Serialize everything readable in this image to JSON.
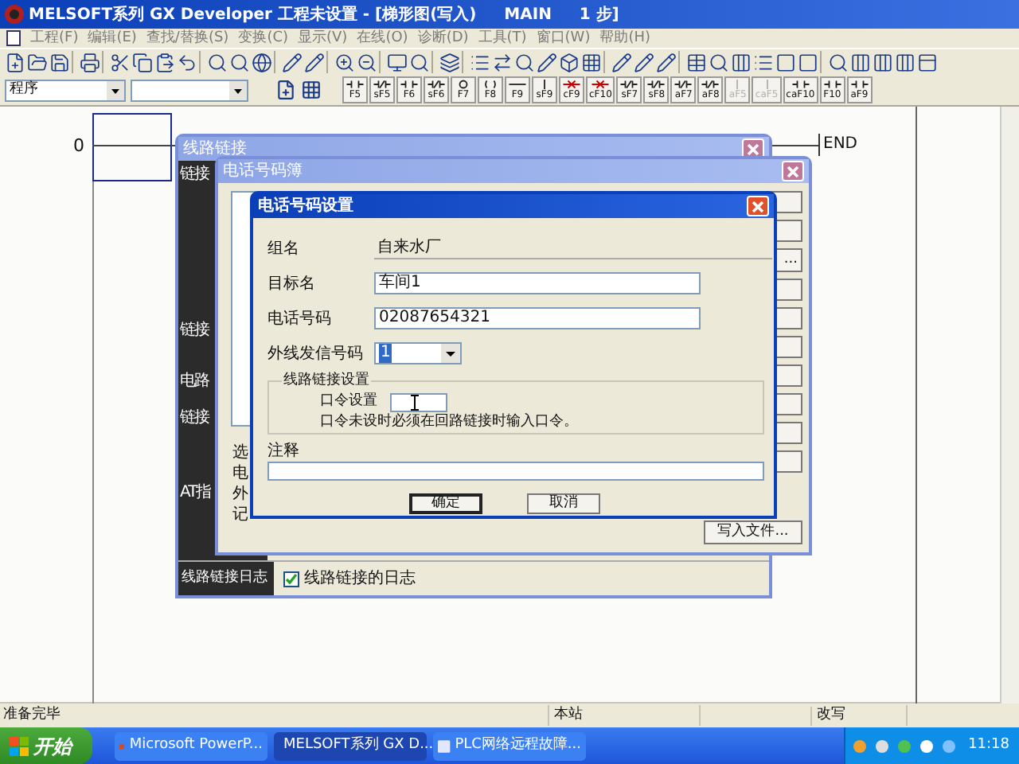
{
  "window": {
    "title": "MELSOFT系列 GX Developer 工程未设置 - [梯形图(写入)     MAIN     1 步]"
  },
  "menu": [
    "工程(F)",
    "编辑(E)",
    "查找/替换(S)",
    "变换(C)",
    "显示(V)",
    "在线(O)",
    "诊断(D)",
    "工具(T)",
    "窗口(W)",
    "帮助(H)"
  ],
  "toolbar_2": {
    "program_select": "程序",
    "function_keys": [
      {
        "label": "F5",
        "disabled": false
      },
      {
        "label": "sF5",
        "disabled": false
      },
      {
        "label": "F6",
        "disabled": false
      },
      {
        "label": "sF6",
        "disabled": false
      },
      {
        "label": "F7",
        "disabled": false
      },
      {
        "label": "F8",
        "disabled": false
      },
      {
        "label": "F9",
        "disabled": false
      },
      {
        "label": "sF9",
        "disabled": false
      },
      {
        "label": "cF9",
        "disabled": false
      },
      {
        "label": "cF10",
        "disabled": false
      },
      {
        "label": "sF7",
        "disabled": false
      },
      {
        "label": "sF8",
        "disabled": false
      },
      {
        "label": "aF7",
        "disabled": false
      },
      {
        "label": "aF8",
        "disabled": false
      },
      {
        "label": "aF5",
        "disabled": true
      },
      {
        "label": "caF5",
        "disabled": true
      },
      {
        "label": "caF10",
        "disabled": false
      },
      {
        "label": "F10",
        "disabled": false
      },
      {
        "label": "aF9",
        "disabled": false
      }
    ]
  },
  "ladder": {
    "step": "0",
    "end": "END"
  },
  "line_link_dialog": {
    "title": "线路链接",
    "side_labels": [
      "链接",
      "链接",
      "电路",
      "链接",
      "AT指"
    ],
    "log_label": "线路链接日志",
    "log_checkbox": {
      "label": "线路链接的日志",
      "checked": true
    }
  },
  "phonebook_dialog": {
    "title": "电话号码簿",
    "cut_labels": [
      "选",
      "电",
      "外",
      "记"
    ],
    "browse_button": "...",
    "write_button": "写入文件..."
  },
  "phone_setting_dialog": {
    "title": "电话号码设置",
    "fields": [
      {
        "label": "组名",
        "value": "自来水厂",
        "kind": "readonly"
      },
      {
        "label": "目标名",
        "value": "车间1",
        "kind": "input"
      },
      {
        "label": "电话号码",
        "value": "02087654321",
        "kind": "input"
      },
      {
        "label": "外线发信号码",
        "value": "1",
        "kind": "select"
      }
    ],
    "group": {
      "title": "线路链接设置",
      "password_label": "口令设置",
      "note": "口令未设时必须在回路链接时输入口令。"
    },
    "comment_label": "注释",
    "buttons": [
      "确定",
      "取消"
    ]
  },
  "status_bar": {
    "status": "准备完毕",
    "station": "本站",
    "mode": "改写"
  },
  "taskbar": {
    "start": "开始",
    "tasks": [
      {
        "label": "Microsoft PowerP...",
        "selected": false
      },
      {
        "label": "MELSOFT系列 GX D...",
        "selected": true
      },
      {
        "label": "PLC网络远程故障...",
        "selected": false
      }
    ],
    "clock": "11:18"
  }
}
